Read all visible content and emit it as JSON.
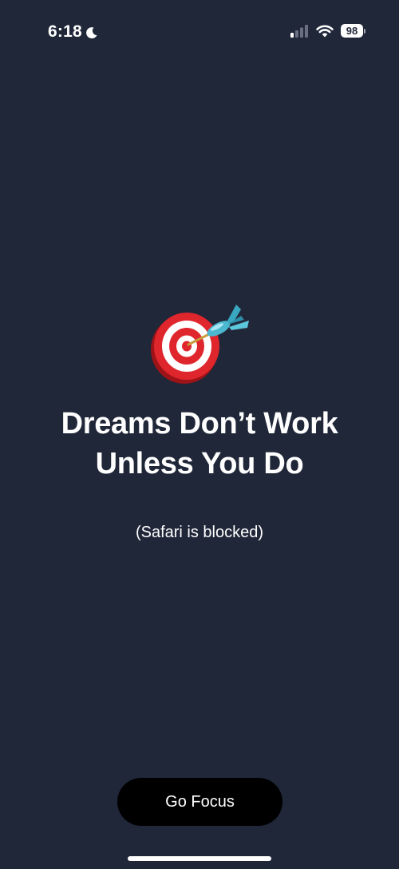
{
  "status_bar": {
    "time": "6:18",
    "battery": "98",
    "icons": [
      "moon-icon",
      "cellular-signal-icon",
      "wifi-icon",
      "battery-icon"
    ]
  },
  "main": {
    "icon": "direct-hit-dart-icon",
    "headline_line1": "Dreams Don’t Work",
    "headline_line2": "Unless You Do",
    "subtitle": "(Safari is blocked)"
  },
  "actions": {
    "go_focus_label": "Go Focus"
  },
  "colors": {
    "background": "#202739",
    "text": "#ffffff",
    "button_bg": "#000000",
    "target_red": "#d8262c",
    "dart_teal": "#4cb8cf"
  }
}
